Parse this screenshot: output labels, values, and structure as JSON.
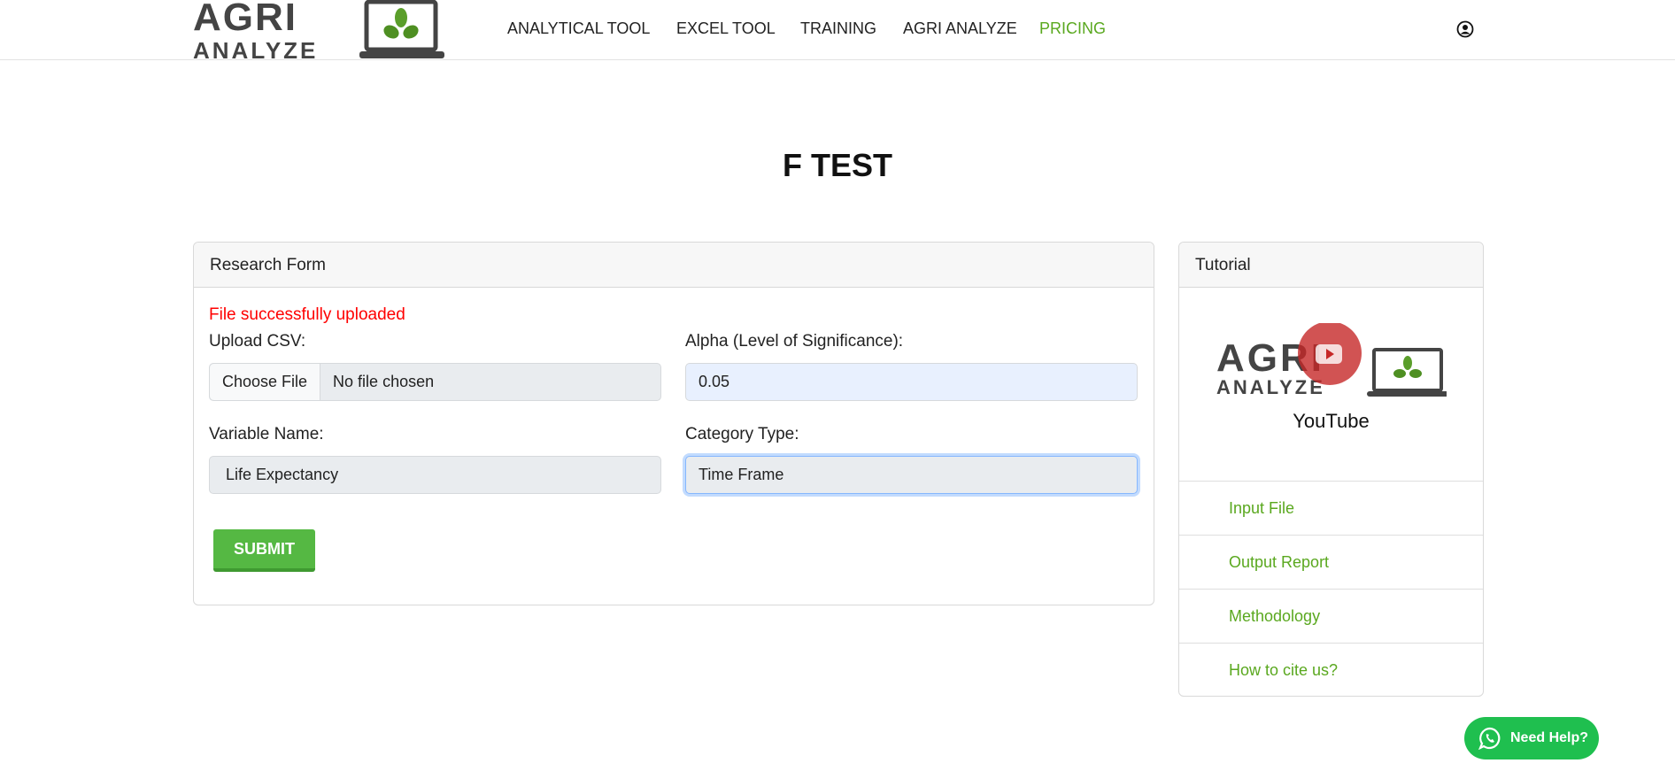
{
  "brand": {
    "logo_text_top": "AGRI",
    "logo_text_bottom": "ANALYZE"
  },
  "nav": {
    "items": [
      {
        "label": "ANALYTICAL TOOL"
      },
      {
        "label": "EXCEL TOOL"
      },
      {
        "label": "TRAINING"
      },
      {
        "label": "AGRI ANALYZE"
      },
      {
        "label": "PRICING",
        "active": true
      }
    ],
    "active_color": "#5aa81f",
    "user_icon": "user-circle-icon"
  },
  "page": {
    "title": "F TEST"
  },
  "form": {
    "header": "Research Form",
    "status_message": "File successfully uploaded",
    "status_color": "#ff0000",
    "upload_label": "Upload CSV:",
    "choose_file_label": "Choose File",
    "file_status": "No file chosen",
    "alpha_label": "Alpha (Level of Significance):",
    "alpha_value": "0.05",
    "variable_label": "Variable Name:",
    "variable_value": "Life Expectancy",
    "category_label": "Category Type:",
    "category_value": "Time Frame",
    "submit_label": "SUBMIT"
  },
  "tutorial": {
    "header": "Tutorial",
    "video_caption": "YouTube",
    "links": [
      {
        "label": "Input File"
      },
      {
        "label": "Output Report"
      },
      {
        "label": "Methodology"
      },
      {
        "label": "How to cite us?"
      }
    ]
  },
  "help": {
    "label": "Need Help?",
    "icon": "whatsapp-icon"
  }
}
